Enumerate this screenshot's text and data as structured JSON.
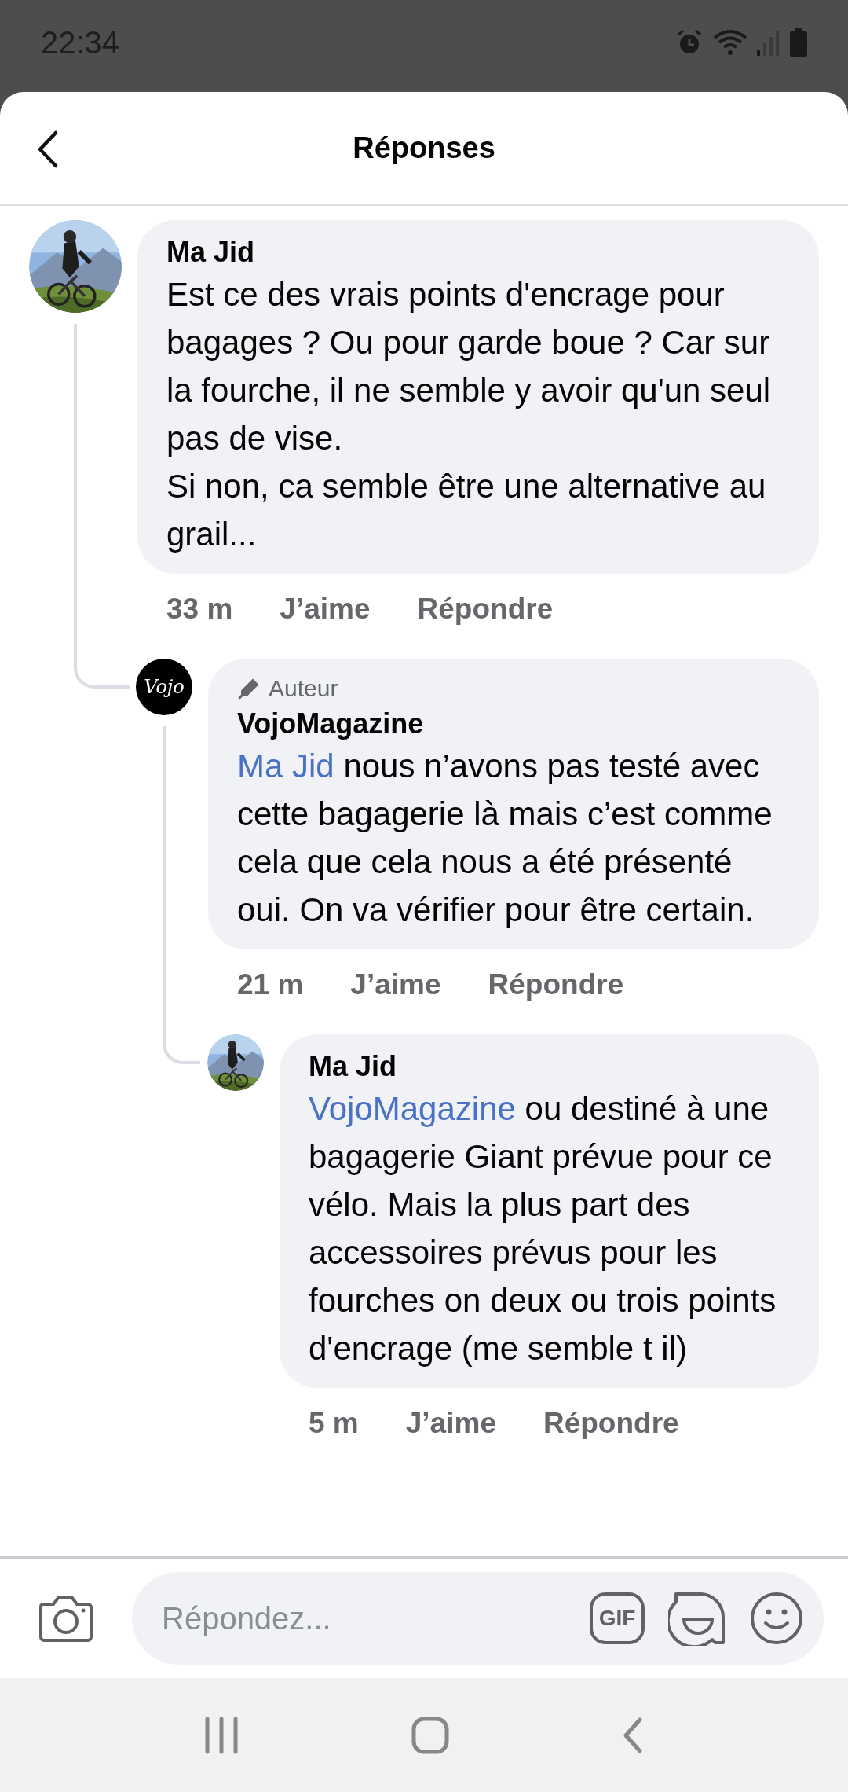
{
  "status_bar": {
    "time": "22:34"
  },
  "header": {
    "title": "Réponses"
  },
  "comments": [
    {
      "author": "Ma Jid",
      "text": "Est ce des vrais points d'encrage pour bagages ? Ou pour garde boue ? Car sur la fourche, il ne semble y avoir qu'un seul pas de vise.\nSi non, ca semble être une alternative au grail...",
      "time": "33 m",
      "like": "J’aime",
      "reply": "Répondre",
      "replies": [
        {
          "badge": "Auteur",
          "author": "VojoMagazine",
          "avatar": {
            "kind": "logo",
            "text": "Vojo"
          },
          "mention": "Ma Jid",
          "text": "nous n’avons pas testé avec cette bagagerie là mais c’est comme cela que cela nous a été présenté oui. On va vérifier pour être certain.",
          "time": "21 m",
          "like": "J’aime",
          "reply": "Répondre",
          "replies": [
            {
              "author": "Ma Jid",
              "mention": "VojoMagazine",
              "text": "ou destiné à une bagagerie Giant prévue pour ce vélo. Mais la plus part des accessoires prévus pour les fourches on deux ou trois points d'encrage (me semble t il)",
              "time": "5 m",
              "like": "J’aime",
              "reply": "Répondre"
            }
          ]
        }
      ]
    }
  ],
  "composer": {
    "placeholder": "Répondez...",
    "gif_label": "GIF"
  }
}
